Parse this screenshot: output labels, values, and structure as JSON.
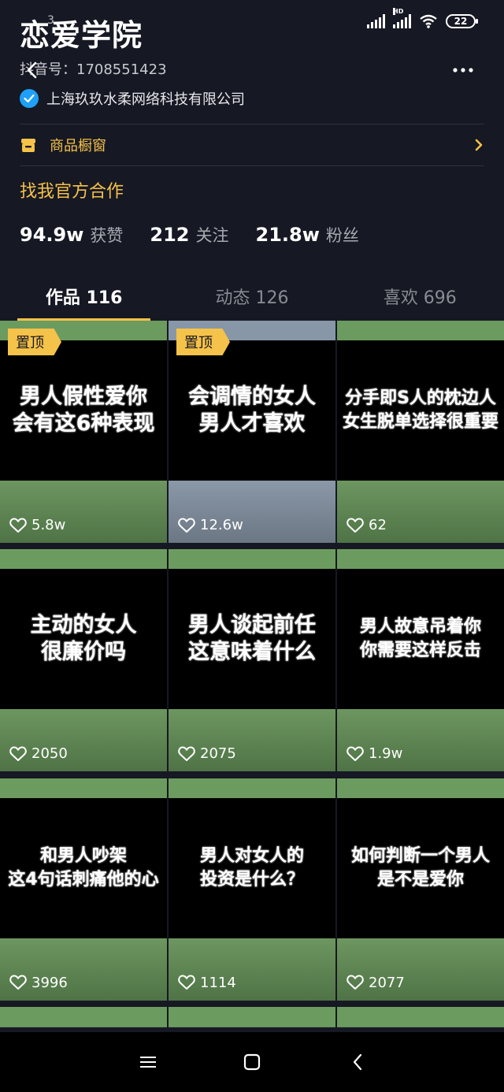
{
  "status": {
    "ghost_time": "3",
    "battery": "22"
  },
  "profile": {
    "name": "恋爱学院",
    "uid": "抖音号：1708551423",
    "verified_org": "上海玖玖水柔网络科技有限公司"
  },
  "shop": {
    "label": "商品橱窗"
  },
  "cooperation": "找我官方合作",
  "stats": [
    {
      "num": "94.9w",
      "label": "获赞"
    },
    {
      "num": "212",
      "label": "关注"
    },
    {
      "num": "21.8w",
      "label": "粉丝"
    }
  ],
  "tabs": [
    {
      "label": "作品 116",
      "active": true
    },
    {
      "label": "动态 126",
      "active": false
    },
    {
      "label": "喜欢 696",
      "active": false
    }
  ],
  "pin_label": "置顶",
  "videos": [
    {
      "caption": "男人假性爱你\n会有这6种表现",
      "likes": "5.8w",
      "pinned": true
    },
    {
      "caption": "会调情的女人\n男人才喜欢",
      "likes": "12.6w",
      "pinned": true
    },
    {
      "caption": "分手即S人的枕边人\n女生脱单选择很重要",
      "likes": "62",
      "pinned": false
    },
    {
      "caption": "主动的女人\n很廉价吗",
      "likes": "2050",
      "pinned": false
    },
    {
      "caption": "男人谈起前任\n这意味着什么",
      "likes": "2075",
      "pinned": false
    },
    {
      "caption": "男人故意吊着你\n你需要这样反击",
      "likes": "1.9w",
      "pinned": false
    },
    {
      "caption": "和男人吵架\n这4句话刺痛他的心",
      "likes": "3996",
      "pinned": false
    },
    {
      "caption": "男人对女人的\n投资是什么？",
      "likes": "1114",
      "pinned": false
    },
    {
      "caption": "如何判断一个男人\n是不是爱你",
      "likes": "2077",
      "pinned": false
    }
  ],
  "colors": {
    "accent": "#f5c24a",
    "background": "#161823",
    "verified": "#1ea0f8"
  },
  "icons": [
    "back-icon",
    "more-icon",
    "verified-icon",
    "shop-icon",
    "chevron-right-icon",
    "heart-icon",
    "menu-icon",
    "home-icon",
    "nav-back-icon"
  ]
}
